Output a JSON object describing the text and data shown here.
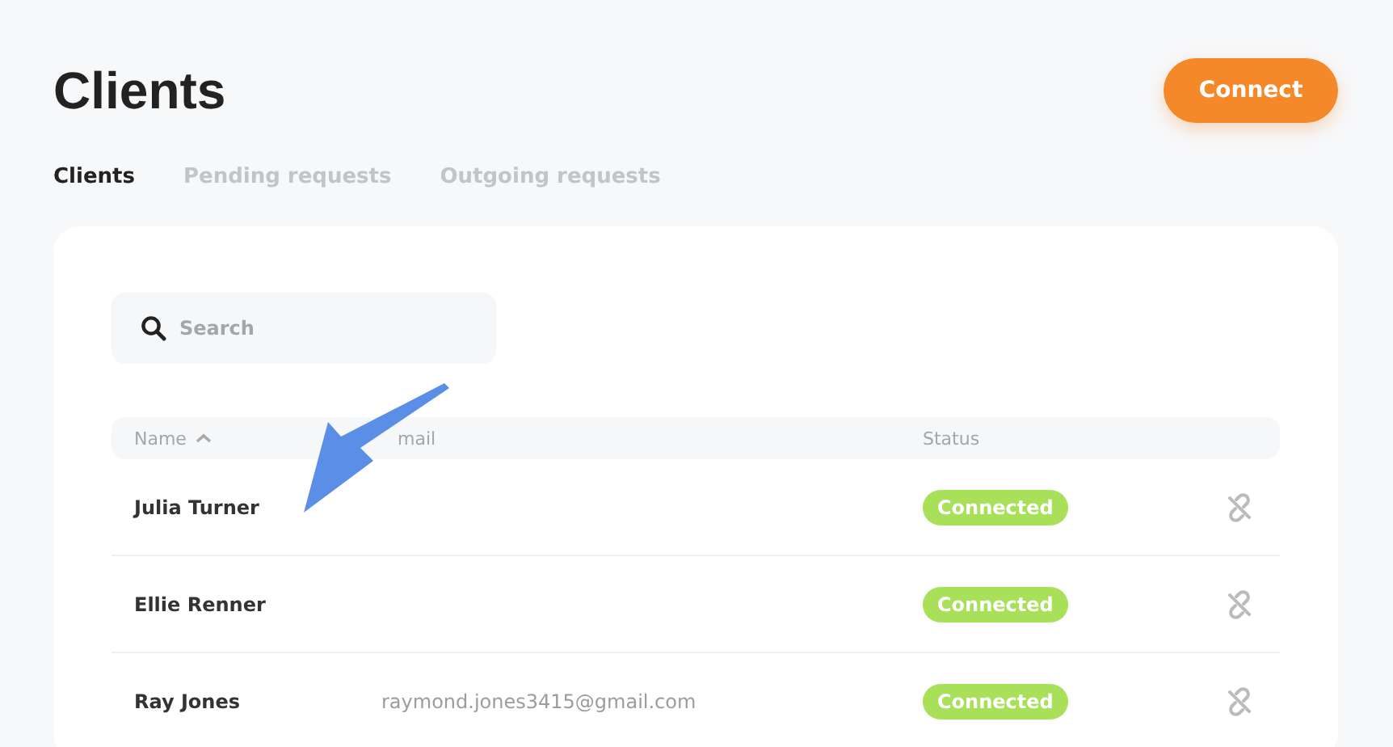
{
  "page": {
    "title": "Clients",
    "action_button": "Connect"
  },
  "tabs": [
    {
      "label": "Clients",
      "selected": true
    },
    {
      "label": "Pending requests",
      "selected": false
    },
    {
      "label": "Outgoing requests",
      "selected": false
    }
  ],
  "search": {
    "placeholder": "Search"
  },
  "table": {
    "columns": [
      {
        "label": "Name",
        "sorted": true
      },
      {
        "label": "mail",
        "sorted": false
      },
      {
        "label": "Status",
        "sorted": false
      }
    ],
    "rows": [
      {
        "name": "Julia Turner",
        "email": "",
        "status": "Connected"
      },
      {
        "name": "Ellie Renner",
        "email": "",
        "status": "Connected"
      },
      {
        "name": "Ray Jones",
        "email": "raymond.jones3415@gmail.com",
        "status": "Connected"
      }
    ]
  }
}
